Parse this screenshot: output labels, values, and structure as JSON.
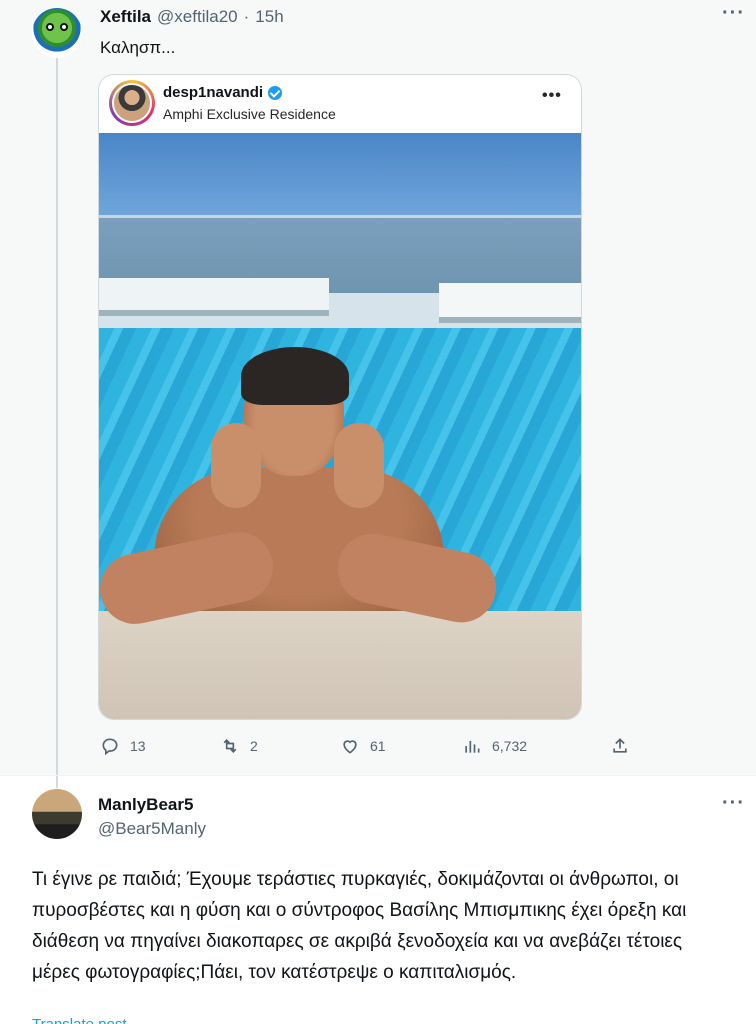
{
  "tweet1": {
    "display_name": "Xeftila",
    "handle": "@xeftila20",
    "separator": "·",
    "time": "15h",
    "text": "Καλησπ...",
    "more": "···",
    "embedded_post": {
      "username": "desp1navandi",
      "location": "Amphi Exclusive Residence",
      "more": "•••"
    },
    "actions": {
      "replies": "13",
      "retweets": "2",
      "likes": "61",
      "views": "6,732"
    }
  },
  "tweet2": {
    "display_name": "ManlyBear5",
    "handle": "@Bear5Manly",
    "more": "···",
    "text": "Τι έγινε ρε παιδιά; Έχουμε τεράστιες πυρκαγιές, δοκιμάζονται οι άνθρωποι, οι πυροσβέστες και η φύση και ο σύντροφος Βασίλης Μπισμπικης έχει όρεξη και διάθεση να πηγαίνει διακοπαρες σε ακριβά ξενοδοχεία και να ανεβάζει τέτοιες μέρες φωτογραφίες;Πάει, τον κατέστρεψε ο καπιταλισμός.",
    "cut_link": "Translate post"
  },
  "colors": {
    "accent": "#1d9bf0",
    "muted": "#536471",
    "highlight_bg": "#f7f9f9"
  }
}
